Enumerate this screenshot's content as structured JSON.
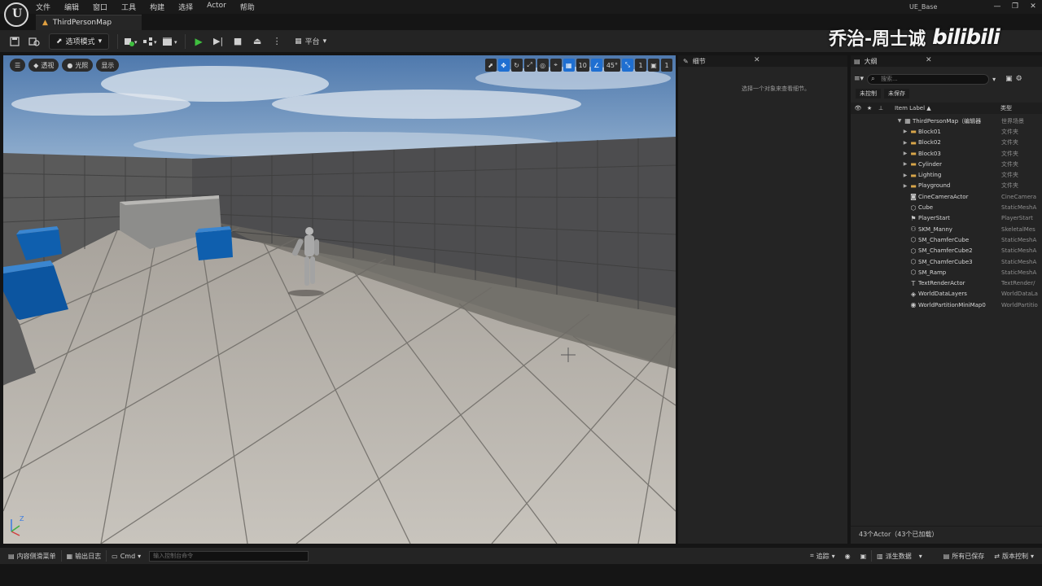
{
  "app": {
    "logo_letter": "U",
    "project_name": "UE_Base",
    "menus": [
      "文件",
      "编辑",
      "窗口",
      "工具",
      "构建",
      "选择",
      "Actor",
      "帮助"
    ],
    "window_controls": [
      "—",
      "❐",
      "✕"
    ]
  },
  "tab": {
    "icon": "level-icon",
    "label": "ThirdPersonMap"
  },
  "toolbar": {
    "mode_label": "选项模式",
    "platform_label": "平台"
  },
  "watermark": {
    "author": "乔治-周士诚",
    "brand": "bilibili"
  },
  "viewport": {
    "left_controls": [
      "透视",
      "光照",
      "显示"
    ],
    "grid_snap": "10",
    "rotation_snap": "45°",
    "scale_snap": "1",
    "camera_speed": "1",
    "axis_label": "Z"
  },
  "details": {
    "title": "细节",
    "hint": "选择一个对象来查看细节。"
  },
  "outliner": {
    "title": "大纲",
    "search_placeholder": "搜索...",
    "filter_chips": [
      "未控制",
      "未保存"
    ],
    "columns": {
      "label": "Item Label ▲",
      "type": "类型"
    },
    "rows": [
      {
        "name": "ThirdPersonMap（编辑器",
        "type": "世界场景",
        "icon": "world-icon",
        "depth": 0,
        "expand": "▼"
      },
      {
        "name": "Block01",
        "type": "文件夹",
        "icon": "folder-icon",
        "depth": 1,
        "expand": "▶"
      },
      {
        "name": "Block02",
        "type": "文件夹",
        "icon": "folder-icon",
        "depth": 1,
        "expand": "▶"
      },
      {
        "name": "Block03",
        "type": "文件夹",
        "icon": "folder-icon",
        "depth": 1,
        "expand": "▶"
      },
      {
        "name": "Cylinder",
        "type": "文件夹",
        "icon": "folder-icon",
        "depth": 1,
        "expand": "▶"
      },
      {
        "name": "Lighting",
        "type": "文件夹",
        "icon": "folder-icon",
        "depth": 1,
        "expand": "▶"
      },
      {
        "name": "Playground",
        "type": "文件夹",
        "icon": "folder-icon",
        "depth": 1,
        "expand": "▶"
      },
      {
        "name": "CineCameraActor",
        "type": "CineCamera",
        "icon": "camera-icon",
        "depth": 1,
        "expand": ""
      },
      {
        "name": "Cube",
        "type": "StaticMeshA",
        "icon": "mesh-icon",
        "depth": 1,
        "expand": ""
      },
      {
        "name": "PlayerStart",
        "type": "PlayerStart",
        "icon": "player-start-icon",
        "depth": 1,
        "expand": ""
      },
      {
        "name": "SKM_Manny",
        "type": "SkeletalMes",
        "icon": "skeletal-icon",
        "depth": 1,
        "expand": ""
      },
      {
        "name": "SM_ChamferCube",
        "type": "StaticMeshA",
        "icon": "mesh-icon",
        "depth": 1,
        "expand": ""
      },
      {
        "name": "SM_ChamferCube2",
        "type": "StaticMeshA",
        "icon": "mesh-icon",
        "depth": 1,
        "expand": ""
      },
      {
        "name": "SM_ChamferCube3",
        "type": "StaticMeshA",
        "icon": "mesh-icon",
        "depth": 1,
        "expand": ""
      },
      {
        "name": "SM_Ramp",
        "type": "StaticMeshA",
        "icon": "mesh-icon",
        "depth": 1,
        "expand": ""
      },
      {
        "name": "TextRenderActor",
        "type": "TextRender/",
        "icon": "text-icon",
        "depth": 1,
        "expand": ""
      },
      {
        "name": "WorldDataLayers",
        "type": "WorldDataLa",
        "icon": "layers-icon",
        "depth": 1,
        "expand": ""
      },
      {
        "name": "WorldPartitionMiniMap0",
        "type": "WorldPartitio",
        "icon": "minimap-icon",
        "depth": 1,
        "expand": ""
      }
    ],
    "footer": "43个Actor（43个已加载）"
  },
  "statusbar": {
    "content_drawer": "内容侧滑菜单",
    "output_log": "输出日志",
    "cmd": "Cmd",
    "console_placeholder": "输入控制台命令",
    "trace": "追踪",
    "derived_data": "派生数据",
    "save_all": "所有已保存",
    "source_control": "版本控制"
  },
  "colors": {
    "accent_blue": "#1f6fd1",
    "play_green": "#3fbf3f",
    "folder": "#d8a64a",
    "cube_blue": "#0f5fae"
  }
}
